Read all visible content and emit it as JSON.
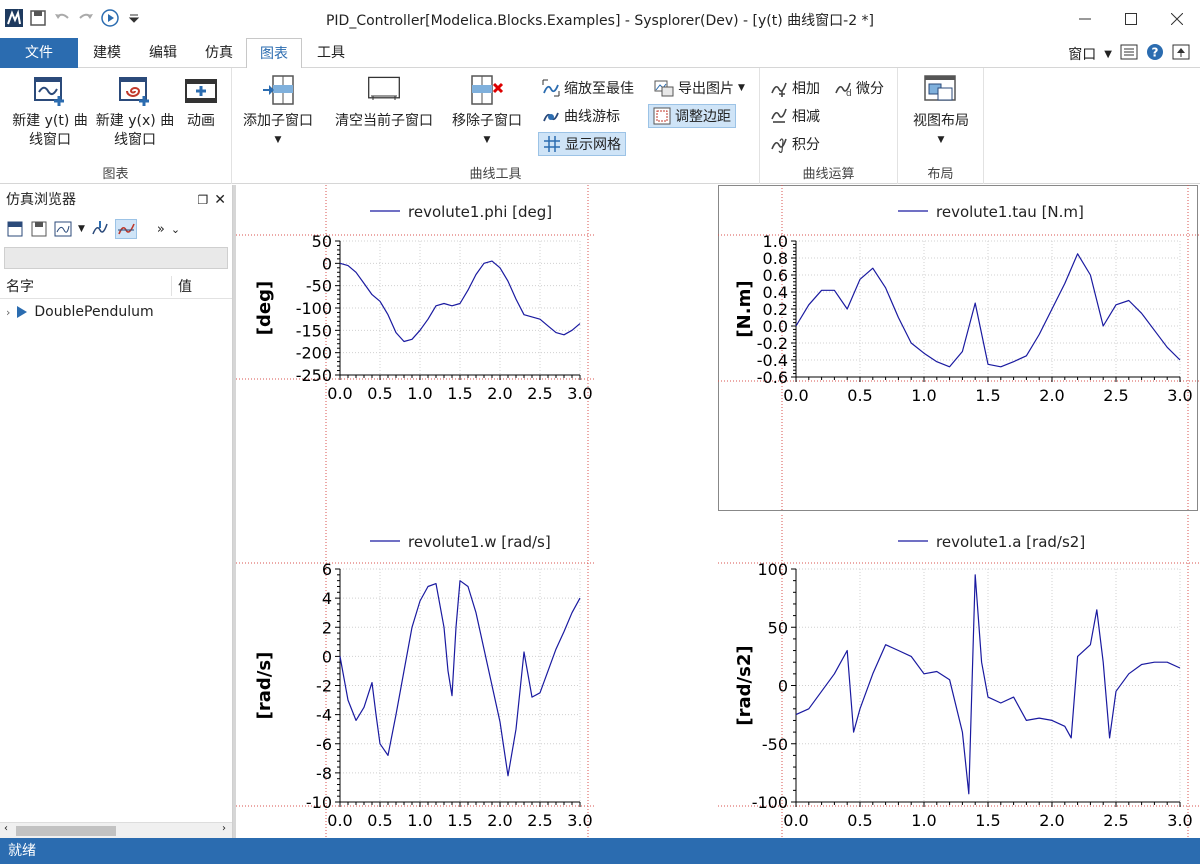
{
  "window": {
    "title": "PID_Controller[Modelica.Blocks.Examples] - Sysplorer(Dev) - [y(t) 曲线窗口-2 *]"
  },
  "menu": {
    "tabs": [
      "文件",
      "建模",
      "编辑",
      "仿真",
      "图表",
      "工具"
    ],
    "active_tab": "图表",
    "right_label": "窗口"
  },
  "ribbon": {
    "groups": {
      "chart": {
        "label": "图表",
        "new_yt_line1": "新建 y(t) 曲",
        "new_yt_line2": "线窗口",
        "new_yx_line1": "新建 y(x) 曲",
        "new_yx_line2": "线窗口",
        "animation": "动画"
      },
      "curve_tools": {
        "label": "曲线工具",
        "add_subwindow": "添加子窗口",
        "clear_subwindow": "清空当前子窗口",
        "remove_subwindow": "移除子窗口",
        "zoom_fit": "缩放至最佳",
        "export_image": "导出图片",
        "curve_cursor": "曲线游标",
        "adjust_margin": "调整边距",
        "show_grid": "显示网格"
      },
      "curve_ops": {
        "label": "曲线运算",
        "add": "相加",
        "differentiate": "微分",
        "subtract": "相减",
        "integrate": "积分"
      },
      "layout": {
        "label": "布局",
        "view_layout": "视图布局"
      }
    }
  },
  "browser": {
    "title": "仿真浏览器",
    "col_name": "名字",
    "col_value": "值",
    "tree_item": "DoublePendulum"
  },
  "status": "就绪",
  "colors": {
    "accent": "#2b6cb0",
    "curve": "#1a1aa0",
    "gridline": "#d9534f"
  },
  "chart_data": [
    {
      "type": "line",
      "series": [
        {
          "name": "revolute1.phi [deg]",
          "x": [
            0.0,
            0.1,
            0.2,
            0.3,
            0.4,
            0.5,
            0.6,
            0.7,
            0.8,
            0.9,
            1.0,
            1.1,
            1.2,
            1.3,
            1.4,
            1.5,
            1.6,
            1.7,
            1.8,
            1.9,
            2.0,
            2.1,
            2.2,
            2.3,
            2.4,
            2.5,
            2.6,
            2.7,
            2.8,
            2.9,
            3.0
          ],
          "y": [
            0,
            -5,
            -20,
            -45,
            -70,
            -85,
            -115,
            -155,
            -175,
            -170,
            -150,
            -125,
            -95,
            -90,
            -95,
            -90,
            -60,
            -25,
            0,
            5,
            -10,
            -40,
            -80,
            -115,
            -120,
            -125,
            -140,
            -155,
            -160,
            -150,
            -135
          ]
        }
      ],
      "ylabel": "[deg]",
      "xticks": [
        "0.0",
        "0.5",
        "1.0",
        "1.5",
        "2.0",
        "2.5",
        "3.0"
      ],
      "yticks": [
        "50",
        "0",
        "-50",
        "-100",
        "-150",
        "-200",
        "-250"
      ],
      "xlim": [
        0,
        3
      ],
      "ylim": [
        -250,
        50
      ]
    },
    {
      "type": "line",
      "series": [
        {
          "name": "revolute1.tau [N.m]",
          "x": [
            0.0,
            0.1,
            0.2,
            0.3,
            0.4,
            0.5,
            0.6,
            0.7,
            0.8,
            0.9,
            1.0,
            1.1,
            1.2,
            1.3,
            1.4,
            1.5,
            1.6,
            1.7,
            1.8,
            1.9,
            2.0,
            2.1,
            2.2,
            2.3,
            2.4,
            2.5,
            2.6,
            2.7,
            2.8,
            2.9,
            3.0
          ],
          "y": [
            0.0,
            0.25,
            0.42,
            0.42,
            0.2,
            0.55,
            0.68,
            0.45,
            0.1,
            -0.2,
            -0.32,
            -0.42,
            -0.48,
            -0.3,
            0.27,
            -0.45,
            -0.48,
            -0.42,
            -0.35,
            -0.1,
            0.2,
            0.5,
            0.85,
            0.6,
            0.0,
            0.25,
            0.3,
            0.15,
            -0.05,
            -0.25,
            -0.4
          ]
        }
      ],
      "ylabel": "[N.m]",
      "xticks": [
        "0.0",
        "0.5",
        "1.0",
        "1.5",
        "2.0",
        "2.5",
        "3.0"
      ],
      "yticks": [
        "1.0",
        "0.8",
        "0.6",
        "0.4",
        "0.2",
        "0.0",
        "-0.2",
        "-0.4",
        "-0.6"
      ],
      "xlim": [
        0,
        3
      ],
      "ylim": [
        -0.6,
        1.0
      ]
    },
    {
      "type": "line",
      "series": [
        {
          "name": "revolute1.w [rad/s]",
          "x": [
            0.0,
            0.1,
            0.2,
            0.3,
            0.4,
            0.45,
            0.5,
            0.6,
            0.7,
            0.8,
            0.9,
            1.0,
            1.1,
            1.2,
            1.3,
            1.35,
            1.4,
            1.45,
            1.5,
            1.6,
            1.7,
            1.8,
            1.9,
            2.0,
            2.1,
            2.2,
            2.3,
            2.4,
            2.5,
            2.6,
            2.7,
            2.8,
            2.9,
            3.0
          ],
          "y": [
            0,
            -3,
            -4.4,
            -3.5,
            -1.8,
            -4,
            -6,
            -6.8,
            -4,
            -1,
            2,
            3.8,
            4.8,
            5,
            2,
            -1,
            -2.7,
            2,
            5.2,
            4.8,
            3,
            0.5,
            -2,
            -4.5,
            -8.2,
            -5,
            0.3,
            -2.8,
            -2.5,
            -1,
            0.5,
            1.7,
            3,
            4
          ]
        }
      ],
      "ylabel": "[rad/s]",
      "xticks": [
        "0.0",
        "0.5",
        "1.0",
        "1.5",
        "2.0",
        "2.5",
        "3.0"
      ],
      "yticks": [
        "6",
        "4",
        "2",
        "0",
        "-2",
        "-4",
        "-6",
        "-8",
        "-10"
      ],
      "xlim": [
        0,
        3
      ],
      "ylim": [
        -10,
        6
      ]
    },
    {
      "type": "line",
      "series": [
        {
          "name": "revolute1.a [rad/s2]",
          "x": [
            0.0,
            0.1,
            0.2,
            0.3,
            0.4,
            0.45,
            0.5,
            0.6,
            0.7,
            0.8,
            0.9,
            1.0,
            1.1,
            1.2,
            1.3,
            1.35,
            1.4,
            1.45,
            1.5,
            1.6,
            1.7,
            1.8,
            1.9,
            2.0,
            2.1,
            2.15,
            2.2,
            2.3,
            2.35,
            2.4,
            2.45,
            2.5,
            2.6,
            2.7,
            2.8,
            2.9,
            3.0
          ],
          "y": [
            -25,
            -20,
            -5,
            10,
            30,
            -40,
            -20,
            10,
            35,
            30,
            25,
            10,
            12,
            5,
            -40,
            -93,
            95,
            20,
            -10,
            -15,
            -10,
            -30,
            -28,
            -30,
            -35,
            -45,
            25,
            35,
            65,
            20,
            -45,
            -5,
            10,
            18,
            20,
            20,
            15
          ]
        }
      ],
      "ylabel": "[rad/s2]",
      "xticks": [
        "0.0",
        "0.5",
        "1.0",
        "1.5",
        "2.0",
        "2.5",
        "3.0"
      ],
      "yticks": [
        "100",
        "50",
        "0",
        "-50",
        "-100"
      ],
      "xlim": [
        0,
        3
      ],
      "ylim": [
        -100,
        100
      ]
    }
  ]
}
